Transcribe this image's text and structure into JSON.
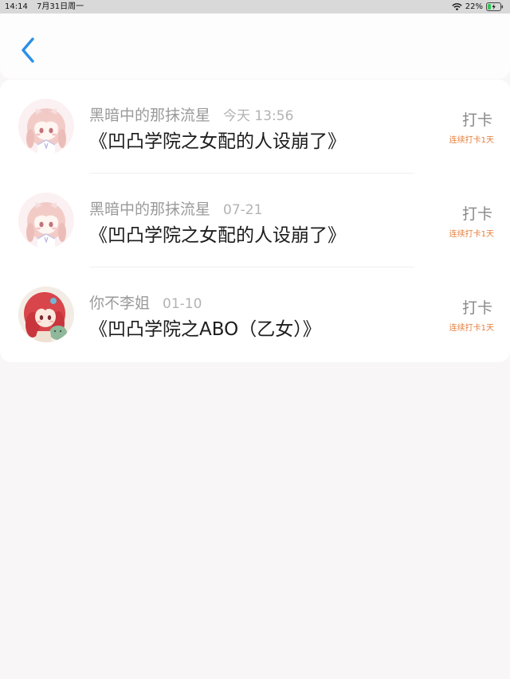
{
  "status_bar": {
    "time": "14:14",
    "date": "7月31日周一",
    "battery": "22%"
  },
  "colors": {
    "accent": "#2b8fe6",
    "streak": "#e67e3a",
    "page_background": "#f8f6f7"
  },
  "nav": {
    "back_icon": "chevron-left-icon"
  },
  "entries": [
    {
      "username": "黑暗中的那抹流星",
      "time": "今天 13:56",
      "title": "《凹凸学院之女配的人设崩了》",
      "action": "打卡",
      "streak": "连续打卡1天"
    },
    {
      "username": "黑暗中的那抹流星",
      "time": "07-21",
      "title": "《凹凸学院之女配的人设崩了》",
      "action": "打卡",
      "streak": "连续打卡1天"
    },
    {
      "username": "你不李姐",
      "time": "01-10",
      "title": "《凹凸学院之ABO（乙女）》",
      "action": "打卡",
      "streak": "连续打卡1天"
    }
  ]
}
